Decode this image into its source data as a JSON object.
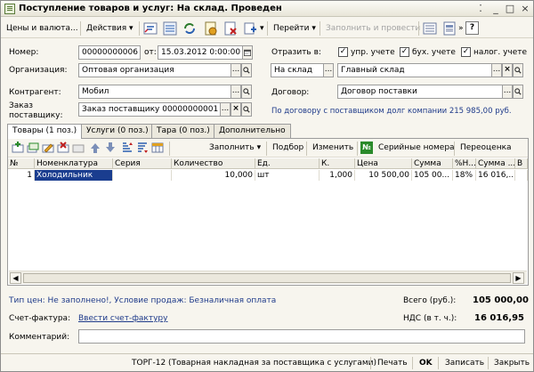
{
  "window": {
    "title": "Поступление товаров и услуг: На склад. Проведен",
    "controls": [
      "⁚",
      "_",
      "□",
      "×"
    ]
  },
  "toolbar": {
    "prices_currency": "Цены и валюта...",
    "actions": "Действия ▾",
    "goto": "Перейти ▾",
    "fill_and_post": "Заполнить и провести",
    "more": "»",
    "help": "?"
  },
  "header": {
    "number_label": "Номер:",
    "number_value": "00000000006",
    "from_label": "от:",
    "date_value": "15.03.2012  0:00:00",
    "reflect_label": "Отразить в:",
    "chk_mgmt": {
      "label": "упр. учете",
      "checked": true
    },
    "chk_acct": {
      "label": "бух. учете",
      "checked": true
    },
    "chk_tax": {
      "label": "налог. учете",
      "checked": true
    },
    "org_label": "Организация:",
    "org_value": "Оптовая организация",
    "warehouse_type": "На склад",
    "warehouse_value": "Главный склад",
    "contractor_label": "Контрагент:",
    "contractor_value": "Мобил",
    "contract_label": "Договор:",
    "contract_value": "Договор поставки",
    "order_label_1": "Заказ",
    "order_label_2": "поставщику:",
    "order_value": "Заказ поставщику 00000000001 о",
    "debt_info": "По договору с поставщиком долг компании 215 985,00 руб."
  },
  "tabs": [
    {
      "label": "Товары (1 поз.)",
      "active": true
    },
    {
      "label": "Услуги (0 поз.)",
      "active": false
    },
    {
      "label": "Тара (0 поз.)",
      "active": false
    },
    {
      "label": "Дополнительно",
      "active": false
    }
  ],
  "table_toolbar": {
    "fill": "Заполнить ▾",
    "selection": "Подбор",
    "change": "Изменить",
    "serial_icon": "№",
    "serials": "Серийные номера",
    "revaluation": "Переоценка"
  },
  "table": {
    "columns": [
      "№",
      "Номенклатура",
      "Серия",
      "Количество",
      "Ед.",
      "К.",
      "Цена",
      "Сумма",
      "%Н...",
      "Сумма ...",
      "В"
    ],
    "rows": [
      [
        "1",
        "Холодильник",
        "",
        "10,000",
        "шт",
        "1,000",
        "10 500,00",
        "105 00...",
        "18%",
        "16 016,...",
        ""
      ]
    ]
  },
  "footer": {
    "price_type_info": "Тип цен: Не заполнено!, Условие продаж: Безналичная оплата",
    "total_label": "Всего (руб.):",
    "total_value": "105 000,00",
    "invoice_label": "Счет-фактура:",
    "invoice_link": "Ввести счет-фактуру",
    "vat_label": "НДС (в т. ч.):",
    "vat_value": "16 016,95",
    "comment_label": "Комментарий:",
    "comment_value": ""
  },
  "statusbar": {
    "torg12": "ТОРГ-12 (Товарная накладная за поставщика с услугами)",
    "print": "Печать",
    "ok": "OK",
    "save": "Записать",
    "close": "Закрыть"
  },
  "colors": {
    "selection": "#1a3d8f",
    "link": "#1f3b8a",
    "window_bg": "#f7f5ee"
  }
}
